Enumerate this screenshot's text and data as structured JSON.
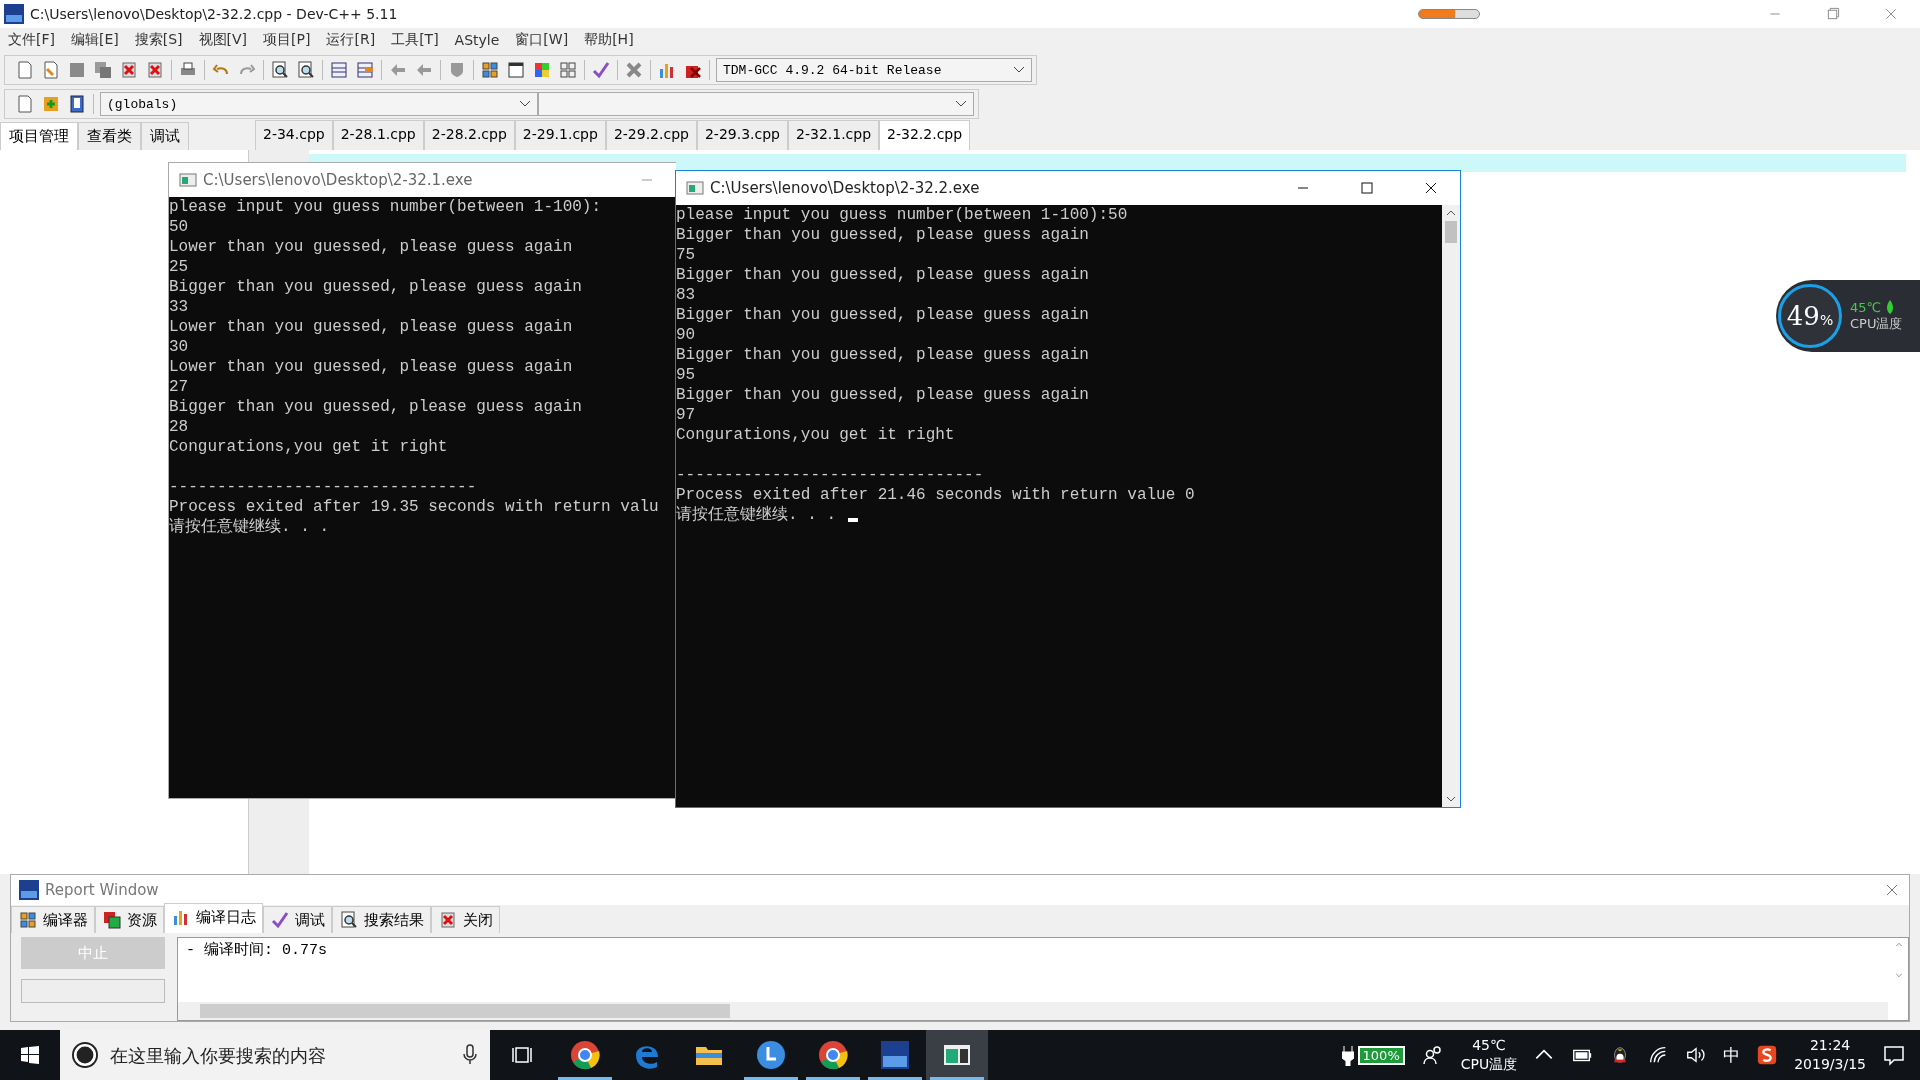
{
  "window": {
    "title": "C:\\Users\\lenovo\\Desktop\\2-32.2.cpp - Dev-C++ 5.11"
  },
  "menu": [
    "文件[F]",
    "编辑[E]",
    "搜索[S]",
    "视图[V]",
    "项目[P]",
    "运行[R]",
    "工具[T]",
    "AStyle",
    "窗口[W]",
    "帮助[H]"
  ],
  "compiler_select": {
    "value": "TDM-GCC 4.9.2 64-bit Release"
  },
  "scope_select": {
    "value": "(globals)"
  },
  "left_tabs": [
    {
      "label": "项目管理",
      "selected": true
    },
    {
      "label": "查看类",
      "selected": false
    },
    {
      "label": "调试",
      "selected": false
    }
  ],
  "file_tabs": [
    {
      "label": "2-34.cpp",
      "selected": false
    },
    {
      "label": "2-28.1.cpp",
      "selected": false
    },
    {
      "label": "2-28.2.cpp",
      "selected": false
    },
    {
      "label": "2-29.1.cpp",
      "selected": false
    },
    {
      "label": "2-29.2.cpp",
      "selected": false
    },
    {
      "label": "2-29.3.cpp",
      "selected": false
    },
    {
      "label": "2-32.1.cpp",
      "selected": false
    },
    {
      "label": "2-32.2.cpp",
      "selected": true
    }
  ],
  "consoles": [
    {
      "title": "C:\\Users\\lenovo\\Desktop\\2-32.1.exe",
      "cursor": false,
      "blocks": [
        [
          "please input you guess number(between 1-100):",
          "50",
          "Lower than you guessed, please guess again",
          "25",
          "Bigger than you guessed, please guess again",
          "33",
          "Lower than you guessed, please guess again",
          "30",
          "Lower than you guessed, please guess again",
          "27",
          "Bigger than you guessed, please guess again",
          "28",
          "Congurations,you get it right"
        ],
        [
          "--------------------------------",
          "Process exited after 19.35 seconds with return valu",
          "请按任意键继续. . ."
        ]
      ]
    },
    {
      "title": "C:\\Users\\lenovo\\Desktop\\2-32.2.exe",
      "cursor": true,
      "blocks": [
        [
          "please input you guess number(between 1-100):50",
          "Bigger than you guessed, please guess again",
          "75",
          "Bigger than you guessed, please guess again",
          "83",
          "Bigger than you guessed, please guess again",
          "90",
          "Bigger than you guessed, please guess again",
          "95",
          "Bigger than you guessed, please guess again",
          "97",
          "Congurations,you get it right"
        ],
        [
          "--------------------------------",
          "Process exited after 21.46 seconds with return value 0",
          "请按任意键继续. . ."
        ]
      ]
    }
  ],
  "cpu_widget": {
    "usage": "49",
    "unit": "%",
    "temp": "45℃",
    "label": "CPU温度"
  },
  "report": {
    "title": "Report Window",
    "tabs": [
      {
        "label": "编译器",
        "kind": "grid",
        "selected": false
      },
      {
        "label": "资源",
        "kind": "stack",
        "selected": false
      },
      {
        "label": "编译日志",
        "kind": "chart",
        "selected": true
      },
      {
        "label": "调试",
        "kind": "check",
        "selected": false
      },
      {
        "label": "搜索结果",
        "kind": "find",
        "selected": false
      },
      {
        "label": "关闭",
        "kind": "close",
        "selected": false
      }
    ],
    "abort_button": {
      "label": "中止",
      "disabled": true
    },
    "log": [
      "- 编译时间: 0.77s"
    ]
  },
  "taskbar": {
    "search": {
      "placeholder": "在这里输入你要搜索的内容"
    },
    "apps": [
      {
        "kind": "chrome",
        "running": true,
        "selected": false
      },
      {
        "kind": "edge",
        "running": false,
        "selected": false
      },
      {
        "kind": "folder",
        "running": false,
        "selected": false
      },
      {
        "kind": "clock",
        "running": true,
        "selected": false
      },
      {
        "kind": "chrome",
        "running": true,
        "selected": false
      },
      {
        "kind": "devcpp",
        "running": true,
        "selected": false
      },
      {
        "kind": "console",
        "running": true,
        "selected": true
      }
    ],
    "battery": "100%",
    "cpu_temp": "45℃",
    "cpu_label": "CPU温度",
    "ime": "中",
    "time": "21:24",
    "date": "2019/3/15"
  }
}
